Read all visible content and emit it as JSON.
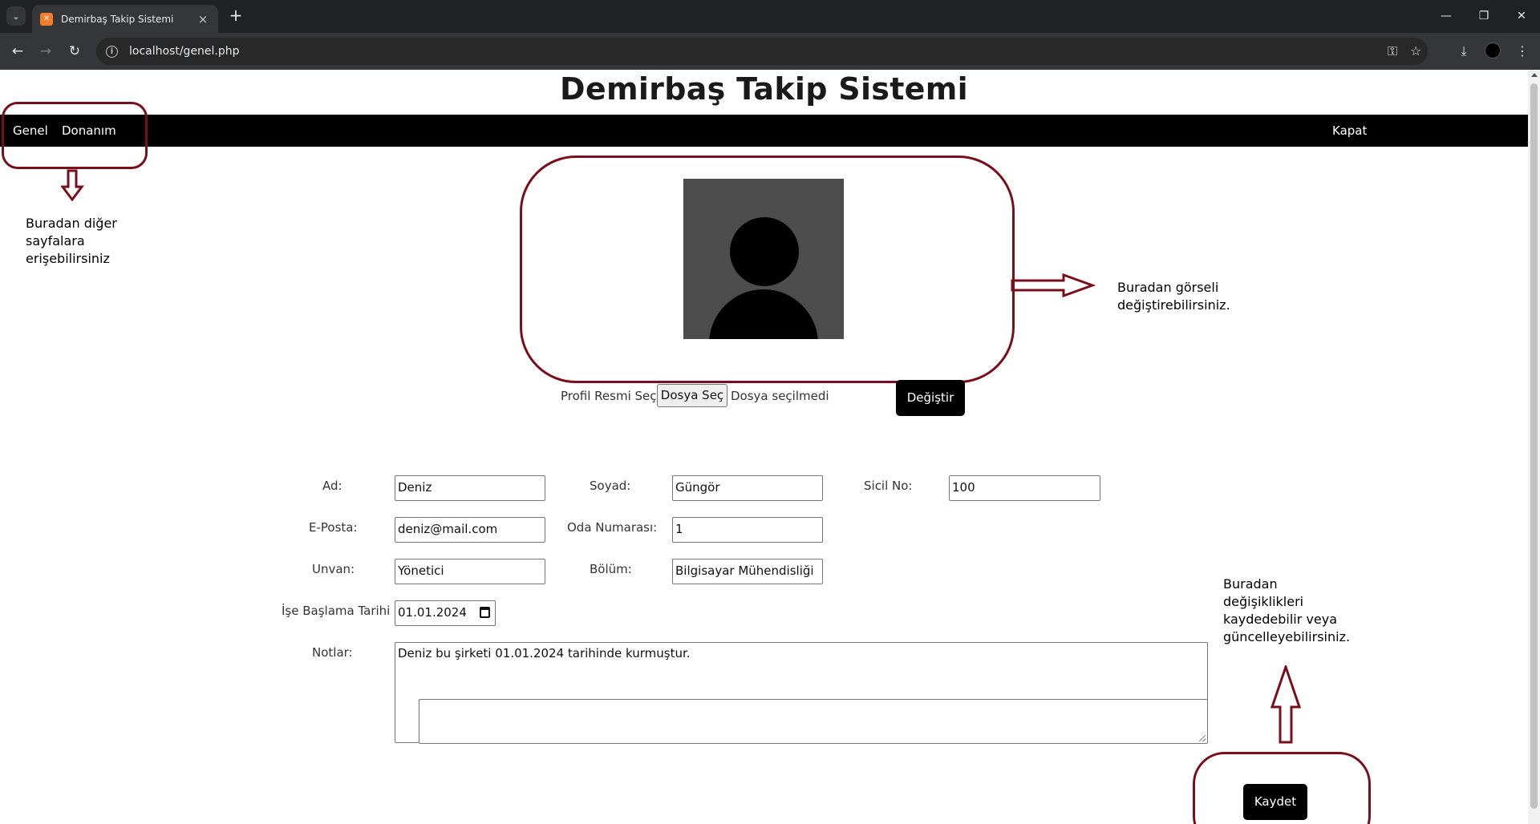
{
  "browser": {
    "tab_title": "Demirbaş Takip Sistemi",
    "url": "localhost/genel.php"
  },
  "site": {
    "title": "Demirbaş Takip Sistemi",
    "nav": {
      "genel": "Genel",
      "donanim": "Donanım",
      "kapat": "Kapat"
    }
  },
  "annotations": {
    "nav_hint": [
      "Buradan diğer",
      "sayfalara",
      "erişebilirsiniz"
    ],
    "image_hint": [
      "Buradan görseli",
      "değiştirebilirsiniz."
    ],
    "save_hint": [
      "Buradan",
      "değişiklikleri",
      "kaydedebilir veya",
      "güncelleyebilirsiniz."
    ]
  },
  "profile": {
    "select_label": "Profil Resmi Seç:",
    "file_button": "Dosya Seç",
    "file_status": "Dosya seçilmedi",
    "change_button": "Değiştir"
  },
  "form": {
    "ad": {
      "label": "Ad:",
      "value": "Deniz"
    },
    "soyad": {
      "label": "Soyad:",
      "value": "Güngör"
    },
    "sicil": {
      "label": "Sicil No:",
      "value": "100"
    },
    "eposta": {
      "label": "E-Posta:",
      "value": "deniz@mail.com"
    },
    "oda": {
      "label": "Oda Numarası:",
      "value": "1"
    },
    "unvan": {
      "label": "Unvan:",
      "value": "Yönetici"
    },
    "bolum": {
      "label": "Bölüm:",
      "value": "Bilgisayar Mühendisliği"
    },
    "baslama": {
      "label": "İşe Başlama Tarihi",
      "value": "01.01.2024"
    },
    "notlar": {
      "label": "Notlar:",
      "value": "Deniz bu şirketi 01.01.2024 tarihinde kurmuştur."
    },
    "save_button": "Kaydet"
  },
  "colors": {
    "annotation": "#7a0f1c",
    "navbar": "#000000",
    "avatar_bg": "#4d4d4d"
  }
}
